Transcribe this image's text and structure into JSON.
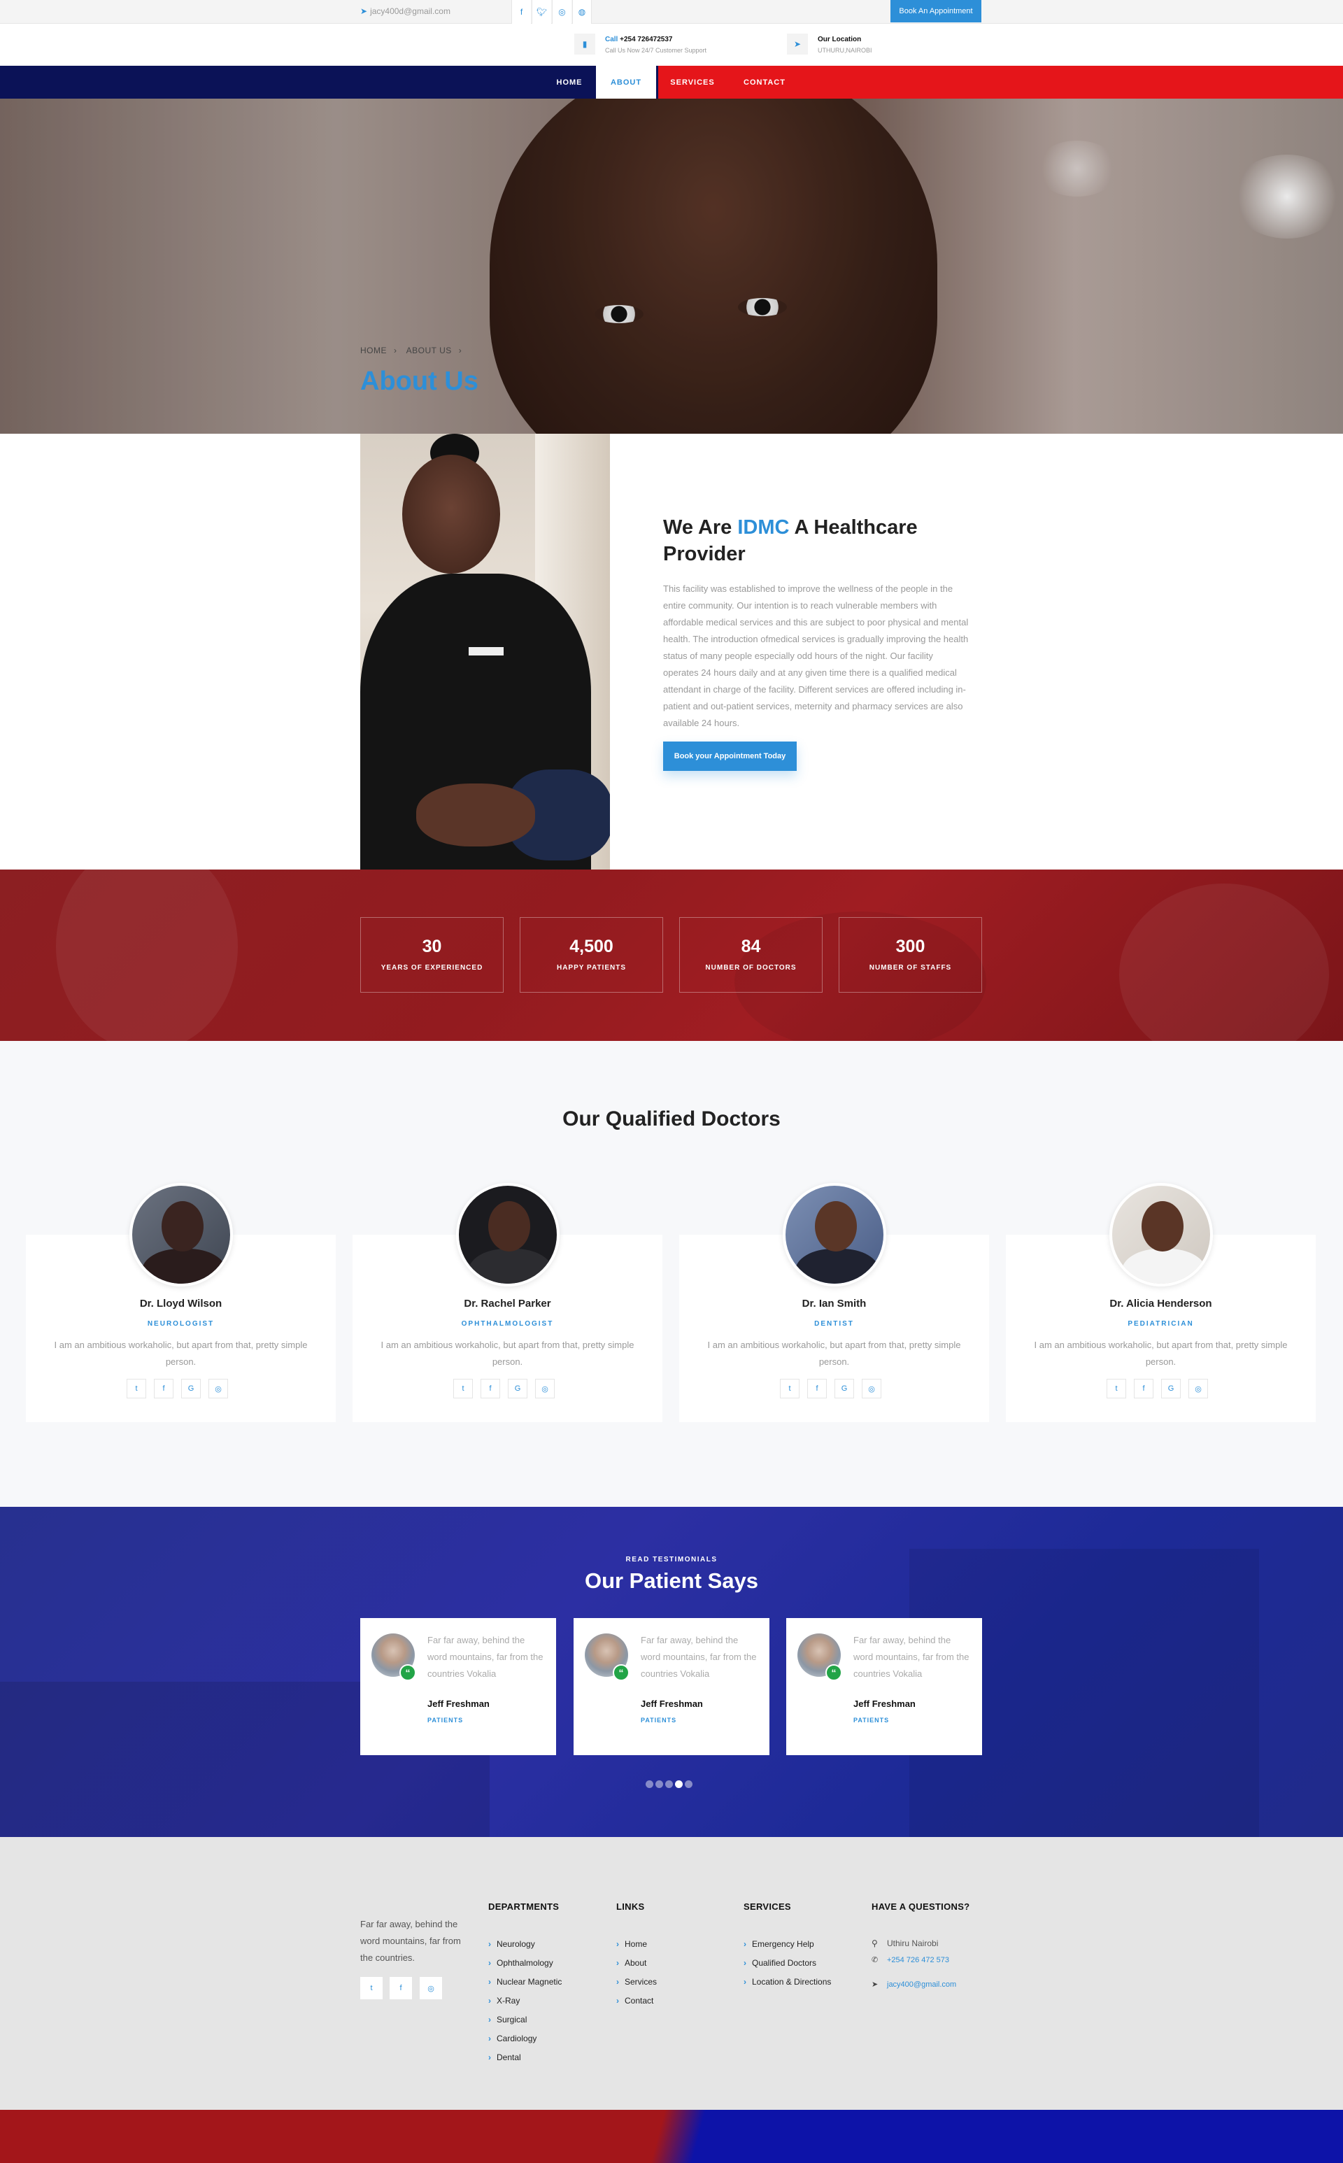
{
  "topbar": {
    "email": "jacy400d@gmail.com",
    "social": [
      "facebook-icon",
      "twitter-icon",
      "instagram-icon",
      "dribbble-icon"
    ],
    "book_label": "Book An Appointment"
  },
  "info": {
    "call_prefix": "Call",
    "phone": "+254 726472537",
    "call_sub": "Call Us Now 24/7 Customer Support",
    "location_title": "Our Location",
    "location_sub": "UTHURU,NAIROBI"
  },
  "nav": [
    {
      "label": "HOME"
    },
    {
      "label": "ABOUT"
    },
    {
      "label": "SERVICES"
    },
    {
      "label": "CONTACT"
    }
  ],
  "hero": {
    "breadcrumb": [
      "HOME",
      "ABOUT US"
    ],
    "title": "About Us"
  },
  "about": {
    "title_pre": "We Are ",
    "title_hl": "IDMC",
    "title_post": " A Healthcare Provider",
    "text": "This facility was established to improve the wellness of the people in the entire community. Our intention is to reach vulnerable members with affordable medical services and this are subject to poor physical and mental health. The introduction ofmedical services is gradually improving the health status of many people especially odd hours of the night. Our facility operates 24 hours daily and at any given time there is a qualified medical attendant in charge of the facility. Different services are offered including in-patient and out-patient services, meternity and pharmacy services are also available 24 hours.",
    "button": "Book your Appointment Today"
  },
  "stats": [
    {
      "num": "30",
      "label": "YEARS OF EXPERIENCED"
    },
    {
      "num": "4,500",
      "label": "HAPPY PATIENTS"
    },
    {
      "num": "84",
      "label": "NUMBER OF DOCTORS"
    },
    {
      "num": "300",
      "label": "NUMBER OF STAFFS"
    }
  ],
  "doctors": {
    "title": "Our Qualified Doctors",
    "items": [
      {
        "name": "Dr. Lloyd Wilson",
        "role": "NEUROLOGIST",
        "desc": "I am an ambitious workaholic, but apart from that, pretty simple person."
      },
      {
        "name": "Dr. Rachel Parker",
        "role": "OPHTHALMOLOGIST",
        "desc": "I am an ambitious workaholic, but apart from that, pretty simple person."
      },
      {
        "name": "Dr. Ian Smith",
        "role": "DENTIST",
        "desc": "I am an ambitious workaholic, but apart from that, pretty simple person."
      },
      {
        "name": "Dr. Alicia Henderson",
        "role": "PEDIATRICIAN",
        "desc": "I am an ambitious workaholic, but apart from that, pretty simple person."
      }
    ],
    "social_icons": [
      "twitter-icon",
      "facebook-icon",
      "google-icon",
      "instagram-icon"
    ]
  },
  "testimonials": {
    "kicker": "READ TESTIMONIALS",
    "title": "Our Patient Says",
    "items": [
      {
        "text": "Far far away, behind the word mountains, far from the countries Vokalia",
        "name": "Jeff Freshman",
        "role": "PATIENTS"
      },
      {
        "text": "Far far away, behind the word mountains, far from the countries Vokalia",
        "name": "Jeff Freshman",
        "role": "PATIENTS"
      },
      {
        "text": "Far far away, behind the word mountains, far from the countries Vokalia",
        "name": "Jeff Freshman",
        "role": "PATIENTS"
      }
    ],
    "slider": {
      "total": 5,
      "active": 4
    }
  },
  "footer": {
    "about": "Far far away, behind the word mountains, far from the countries.",
    "social": [
      "twitter-icon",
      "facebook-icon",
      "instagram-icon"
    ],
    "departments": {
      "title": "DEPARTMENTS",
      "items": [
        "Neurology",
        "Ophthalmology",
        "Nuclear Magnetic",
        "X-Ray",
        "Surgical",
        "Cardiology",
        "Dental"
      ]
    },
    "links": {
      "title": "LINKS",
      "items": [
        "Home",
        "About",
        "Services",
        "Contact"
      ]
    },
    "services": {
      "title": "SERVICES",
      "items": [
        "Emergency Help",
        "Qualified Doctors",
        "Location & Directions"
      ]
    },
    "contact": {
      "title": "HAVE A QUESTIONS?",
      "address": "Uthiru Nairobi",
      "phone": "+254 726 472 573",
      "email": "jacy400@gmail.com"
    }
  },
  "colors": {
    "accent": "#2d8fd8",
    "navy": "#0b1257",
    "red": "#e5151a",
    "stats_red": "#931b1f",
    "testimonial_blue": "#2c2fa3",
    "footer_bg": "#e5e5e5"
  }
}
